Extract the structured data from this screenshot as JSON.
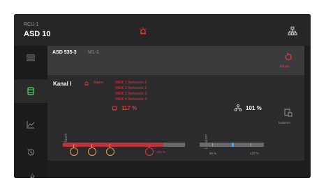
{
  "device": {
    "unit_id": "RCU-1",
    "unit_name": "ASD 10",
    "colors": {
      "alarm": "#e53935",
      "detector": "#f39c3a",
      "flow_marker": "#4fa8e0",
      "active": "#4cd964"
    }
  },
  "sidebar": {
    "items": [
      {
        "icon": "list-icon"
      },
      {
        "icon": "device-icon",
        "active": true
      },
      {
        "icon": "chart-icon"
      },
      {
        "icon": "history-icon"
      },
      {
        "icon": "wrench-icon"
      }
    ]
  },
  "header": {
    "model": "ASD 535-3",
    "module": "M1-1",
    "reset_label": "Reset"
  },
  "channel": {
    "name": "Kanal I",
    "alarm_label": "Alarm",
    "pipes": [
      "REK 1 Rohrnetz 1",
      "REK 2 Rohrnetz 2",
      "REK 3 Rohrnetz 3",
      "REK 4 Rohrnetz 4"
    ],
    "smoke_label": "Rauch",
    "smoke_value": "117 %",
    "smoke_fraction": 0.82,
    "threshold_label": "100 %",
    "airflow_label": "Luftstrom",
    "airflow_value": "101 %",
    "airflow_min": "80 %",
    "airflow_max": "120 %",
    "isolate_label": "Isolieren"
  }
}
